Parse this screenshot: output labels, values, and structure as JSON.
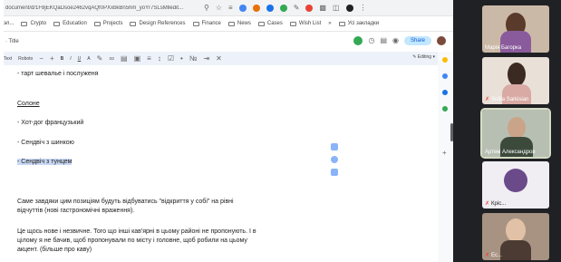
{
  "browser": {
    "url": "document/d/1F8jEKQaDsoe2462vqAQf0PXxbkBn5hm_yoYr7SLsMlledit...",
    "bookmarks": [
      {
        "label": "эл..."
      },
      {
        "label": "Crypto"
      },
      {
        "label": "Education"
      },
      {
        "label": "Projects"
      },
      {
        "label": "Design References"
      },
      {
        "label": "Finance"
      },
      {
        "label": "News"
      },
      {
        "label": "Cases"
      },
      {
        "label": "Wish List"
      },
      {
        "label": "»"
      },
      {
        "label": "Усі закладки"
      }
    ]
  },
  "doc": {
    "title": "· Title",
    "share_label": "Share",
    "toolbar": {
      "mode": "Text",
      "font": "Roboto",
      "editing": "Editing"
    },
    "lines": [
      "- тарт шевалье і послуженя",
      "Солоне",
      "- Хот-дог французький",
      "- Сендвіч з шинкою",
      "- Сендвіч з тунцем",
      "Саме завдяки цим позиціям будуть відбуватись \"відкриття у собі\" на рівні",
      "відчуттів (нові гастрономічні враження).",
      "Це щось нове і незвичне. Того що інші кав'ярні в цьому районі не пропонують. І в",
      "цілому я не бачив, щоб пропонували по місту і головне, щоб робили на цьому",
      "акцент. (більше про каву)"
    ]
  },
  "participants": [
    {
      "name": "Марія Багорка"
    },
    {
      "name": "Sofiia Sarkisian"
    },
    {
      "name": "Артем Александров"
    },
    {
      "name": "Кріс..."
    },
    {
      "name": "Ес..."
    }
  ],
  "colors": {
    "highlight": "#c8d7f4",
    "share_bg": "#c2e7ff",
    "active_tile_border": "#d5dcc4",
    "call_bg": "#202124"
  }
}
